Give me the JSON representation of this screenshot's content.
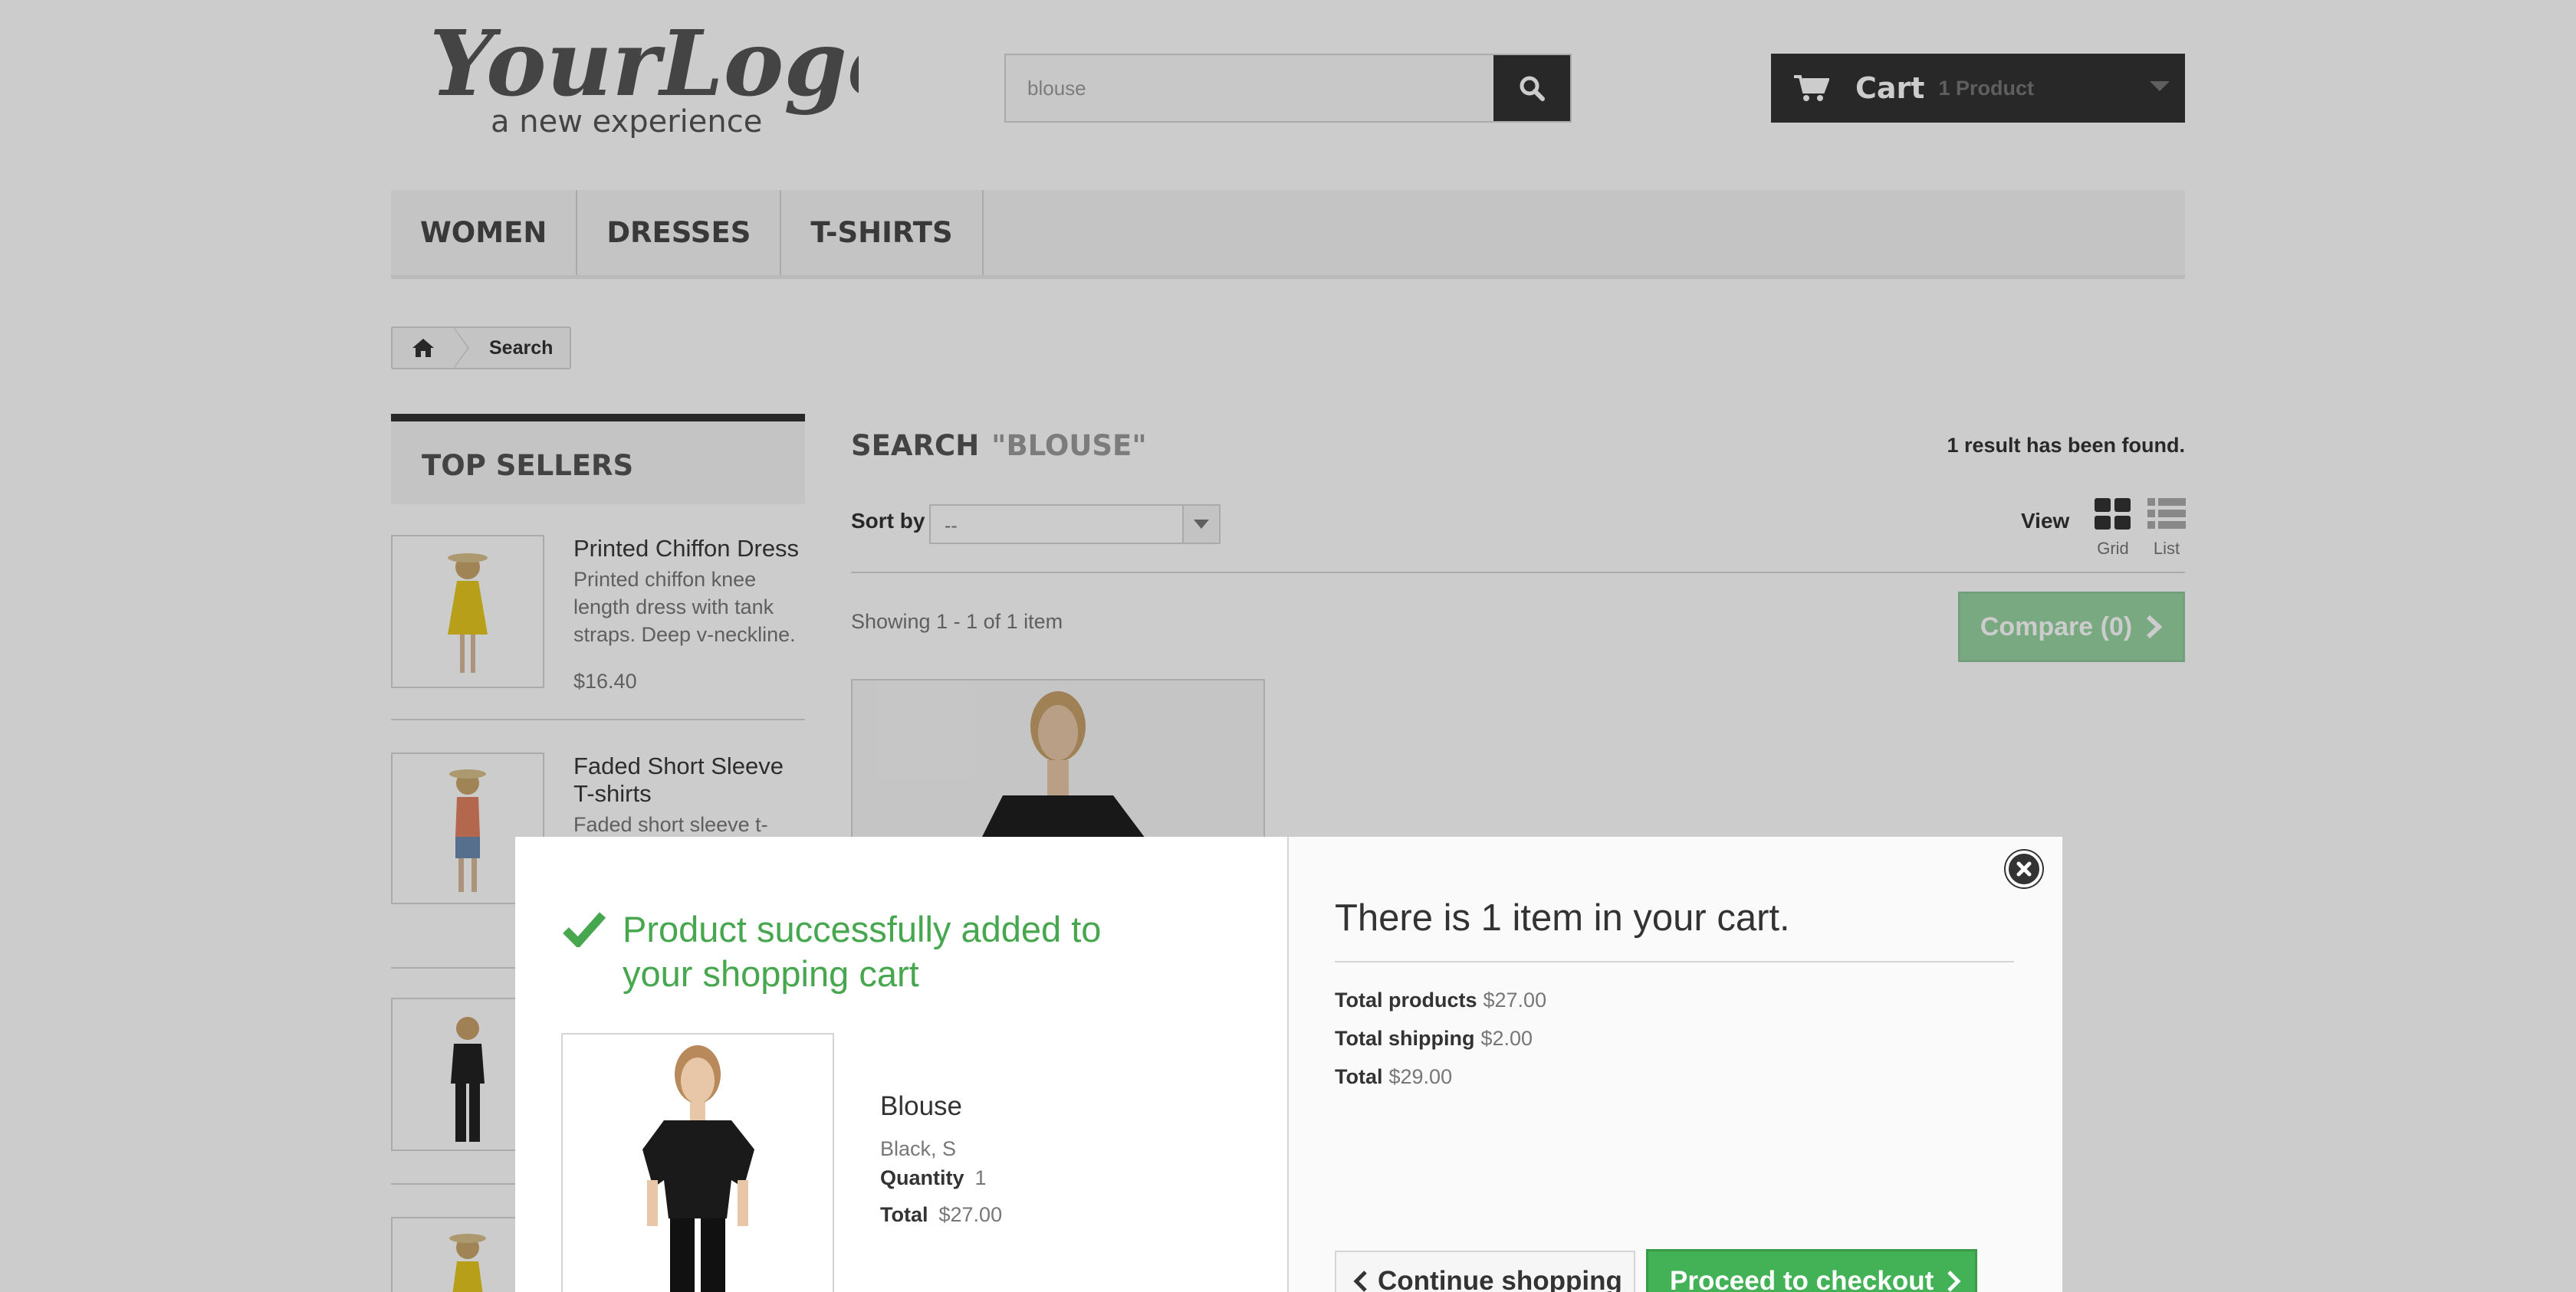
{
  "header": {
    "logo_main": "YourLogo",
    "logo_tagline": "a new experience",
    "search_value": "blouse",
    "cart_label": "Cart",
    "cart_count": "1 Product"
  },
  "menu": {
    "items": [
      "WOMEN",
      "DRESSES",
      "T-SHIRTS"
    ]
  },
  "breadcrumb": {
    "current": "Search"
  },
  "top_sellers": {
    "title": "TOP SELLERS",
    "items": [
      {
        "name": "Printed Chiffon Dress",
        "desc": "Printed chiffon knee length dress with tank straps. Deep v-neckline.",
        "price": "$16.40"
      },
      {
        "name": "Faded Short Sleeve T-shirts",
        "desc": "Faded short sleeve t-shirt",
        "price": ""
      }
    ]
  },
  "search": {
    "title": "SEARCH",
    "query": "\"BLOUSE\"",
    "results": "1 result has been found.",
    "sort_label": "Sort by",
    "sort_value": "--",
    "view_label": "View",
    "view_grid": "Grid",
    "view_list": "List",
    "showing": "Showing 1 - 1 of 1 item",
    "compare": "Compare (0)"
  },
  "modal": {
    "success": "Product successfully added to your shopping cart",
    "product_name": "Blouse",
    "product_attrs": "Black, S",
    "quantity_label": "Quantity",
    "quantity_value": "1",
    "total_label": "Total",
    "total_value": "$27.00",
    "cart_heading": "There is 1 item in your cart.",
    "total_products_label": "Total products",
    "total_products_value": "$27.00",
    "total_shipping_label": "Total shipping",
    "total_shipping_value": "$2.00",
    "grand_total_label": "Total",
    "grand_total_value": "$29.00",
    "continue": "Continue shopping",
    "checkout": "Proceed to checkout"
  },
  "colors": {
    "accent_green": "#43b155",
    "success_text": "#46a74e",
    "dark": "#333333"
  }
}
